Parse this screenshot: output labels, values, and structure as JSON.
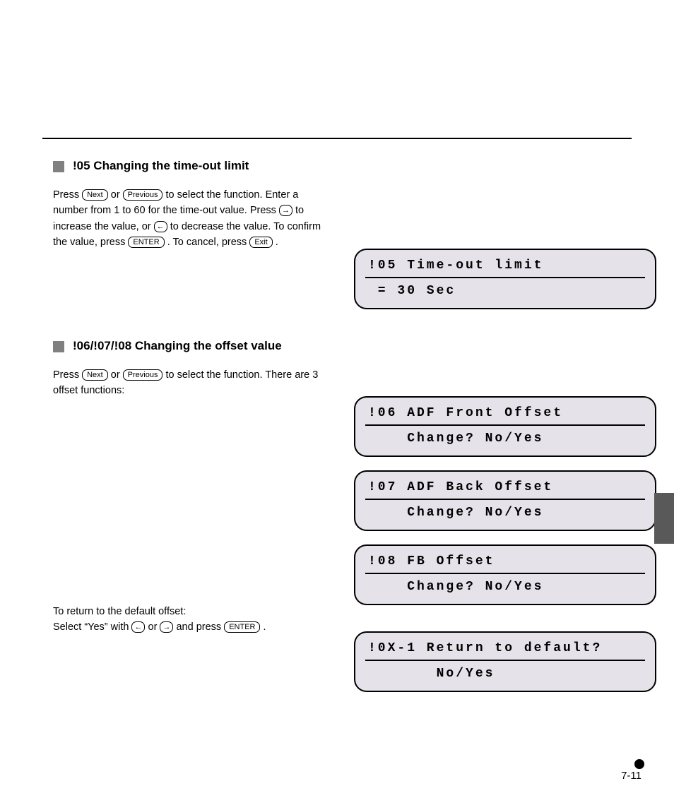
{
  "header": {
    "rule": true
  },
  "keys": {
    "next": "Next",
    "previous": "Previous",
    "enter": "ENTER",
    "exit": "Exit",
    "left": "←",
    "right": "→"
  },
  "section1": {
    "title": "!05 Changing the time-out limit",
    "body_parts": [
      "Press ",
      "K_NEXT",
      " or ",
      "K_PREV",
      " to select the function.",
      " Enter a number from 1 to 60 for the time-out value. Press ",
      "K_RIGHT",
      " to increase the value, or ",
      "K_LEFT",
      " to decrease the value. To confirm the value, press ",
      "K_ENTER",
      ". To cancel, press ",
      "K_EXIT",
      "."
    ]
  },
  "section2": {
    "title": "!06/!07/!08 Changing the offset value",
    "body_parts": [
      "Press ",
      "K_NEXT",
      " or ",
      "K_PREV",
      " to select the function.",
      " There are 3 offset functions:"
    ],
    "return_msg_parts": [
      "To return to the default offset:",
      " Select “Yes” with ",
      "K_LEFT",
      " or ",
      "K_RIGHT",
      " and press ",
      "K_ENTER",
      "."
    ]
  },
  "lcd": {
    "l1a": "!05 Time-out limit",
    "l1b": " = 30 Sec",
    "l2a": "!06 ADF Front Offset",
    "l2b": "    Change? No/Yes",
    "l3a": "!07 ADF Back Offset",
    "l3b": "    Change? No/Yes",
    "l4a": "!08 FB Offset",
    "l4b": "    Change? No/Yes",
    "l5a": "!0X-1 Return to default?",
    "l5b": "       No/Yes"
  },
  "footer": {
    "label": "7-11"
  }
}
